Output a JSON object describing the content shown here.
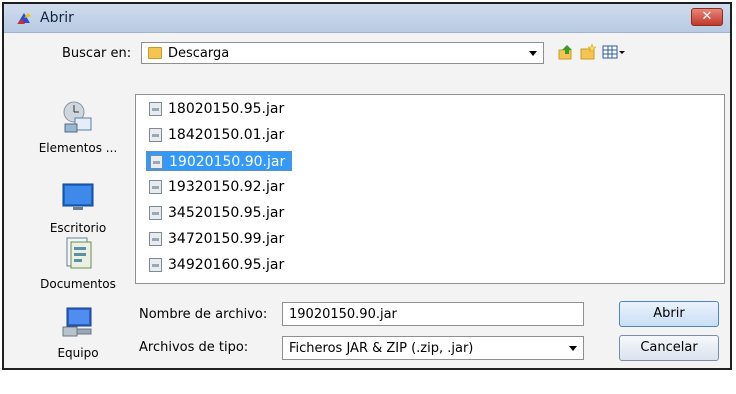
{
  "window": {
    "title": "Abrir",
    "close_label": "✕"
  },
  "lookin": {
    "label": "Buscar en:",
    "value": "Descarga"
  },
  "places": [
    {
      "label": "Elementos ..."
    },
    {
      "label": "Escritorio"
    },
    {
      "label": "Documentos"
    },
    {
      "label": "Equipo"
    }
  ],
  "files": [
    {
      "name": "18020150.95.jar"
    },
    {
      "name": "18420150.01.jar"
    },
    {
      "name": "19020150.90.jar"
    },
    {
      "name": "19320150.92.jar"
    },
    {
      "name": "34520150.95.jar"
    },
    {
      "name": "34720150.99.jar"
    },
    {
      "name": "34920160.95.jar"
    }
  ],
  "selected_file": "19020150.90.jar",
  "filename": {
    "label": "Nombre de archivo:",
    "value": "19020150.90.jar"
  },
  "filetype": {
    "label": "Archivos de tipo:",
    "value": "Ficheros JAR & ZIP (.zip, .jar)"
  },
  "buttons": {
    "open": "Abrir",
    "cancel": "Cancelar"
  },
  "colors": {
    "selection": "#3399ff",
    "close": "#c0392b"
  }
}
